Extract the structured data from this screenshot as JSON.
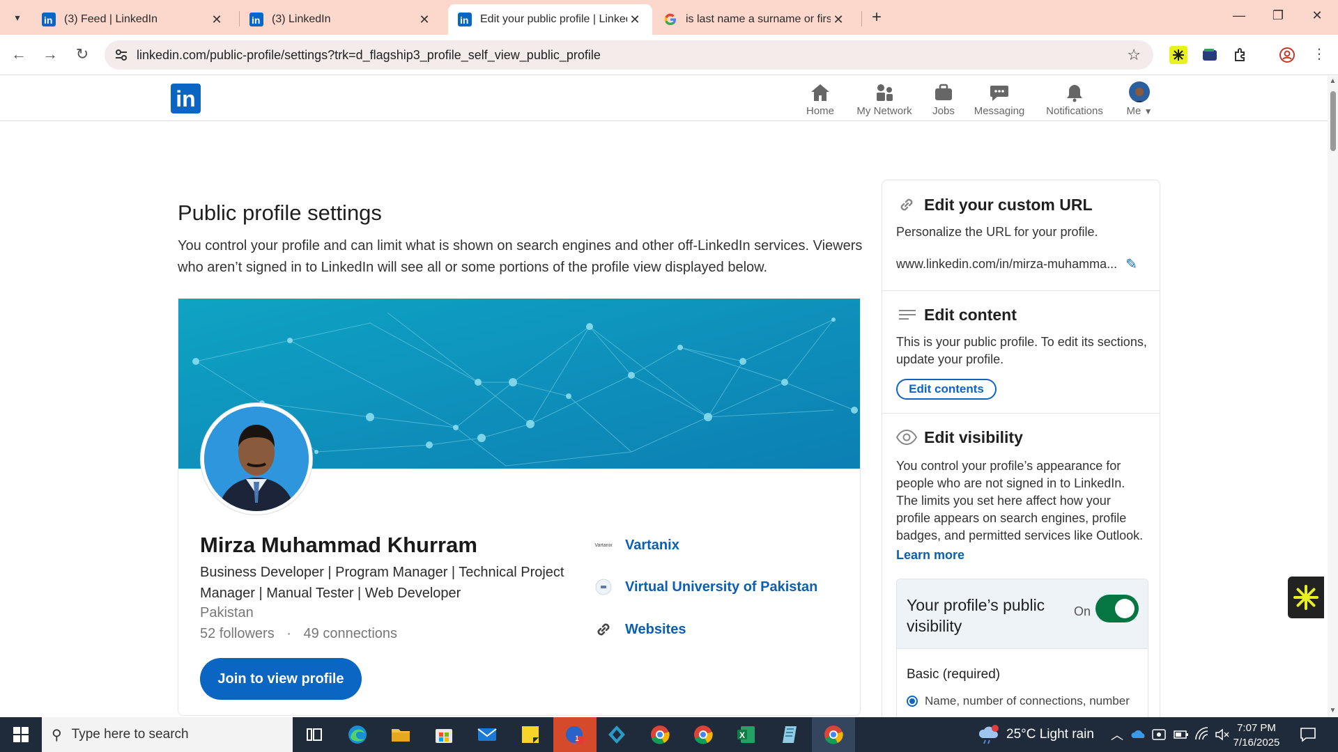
{
  "browser": {
    "tabs": [
      {
        "title": "(3) Feed | LinkedIn",
        "active": false
      },
      {
        "title": "(3) LinkedIn",
        "active": false
      },
      {
        "title": "Edit your public profile | LinkedIn",
        "active": true
      },
      {
        "title": "is last name a surname or first name",
        "active": false
      }
    ],
    "url": "linkedin.com/public-profile/settings?trk=d_flagship3_profile_self_view_public_profile"
  },
  "li_nav": {
    "logo": "in",
    "items": [
      {
        "label": "Home",
        "icon": "home-icon"
      },
      {
        "label": "My Network",
        "icon": "network-icon"
      },
      {
        "label": "Jobs",
        "icon": "briefcase-icon"
      },
      {
        "label": "Messaging",
        "icon": "chat-icon"
      },
      {
        "label": "Notifications",
        "icon": "bell-icon"
      },
      {
        "label": "Me",
        "icon": "avatar"
      }
    ]
  },
  "main": {
    "title": "Public profile settings",
    "description": "You control your profile and can limit what is shown on search engines and other off-LinkedIn services. Viewers who aren’t signed in to LinkedIn will see all or some portions of the profile view displayed below."
  },
  "profile": {
    "name": "Mirza Muhammad Khurram",
    "headline": "Business Developer | Program Manager | Technical Project Manager | Manual Tester | Web Developer",
    "location": "Pakistan",
    "followers": "52 followers",
    "separator": "·",
    "connections": "49 connections",
    "join_label": "Join to view profile",
    "orgs": [
      {
        "label": "Vartanix",
        "logo_text": "Vartanix"
      },
      {
        "label": "Virtual University of Pakistan"
      },
      {
        "label": "Websites"
      }
    ]
  },
  "panel": {
    "url_section": {
      "title": "Edit your custom URL",
      "desc": "Personalize the URL for your profile.",
      "url": "www.linkedin.com/in/mirza-muhamma..."
    },
    "content_section": {
      "title": "Edit content",
      "desc": "This is your public profile. To edit its sections, update your profile.",
      "button": "Edit contents"
    },
    "visibility_section": {
      "title": "Edit visibility",
      "desc": "You control your profile’s appearance for people who are not signed in to LinkedIn. The limits you set here affect how your profile appears on search engines, profile badges, and permitted services like Outlook.",
      "learn_more": "Learn more",
      "box_title": "Your profile’s public visibility",
      "toggle_label": "On",
      "toggle_on": true,
      "basic_label": "Basic (required)",
      "radio_label": "Name, number of connections, number"
    }
  },
  "taskbar": {
    "search_placeholder": "Type here to search",
    "weather": "25°C  Light rain",
    "time": "7:07 PM",
    "date": "7/16/2025",
    "badge_count": "1"
  },
  "colors": {
    "linkedin_blue": "#0a66c2",
    "toggle_green": "#057642",
    "tabstrip": "#fbd7cc",
    "taskbar": "#1f2b3a"
  }
}
